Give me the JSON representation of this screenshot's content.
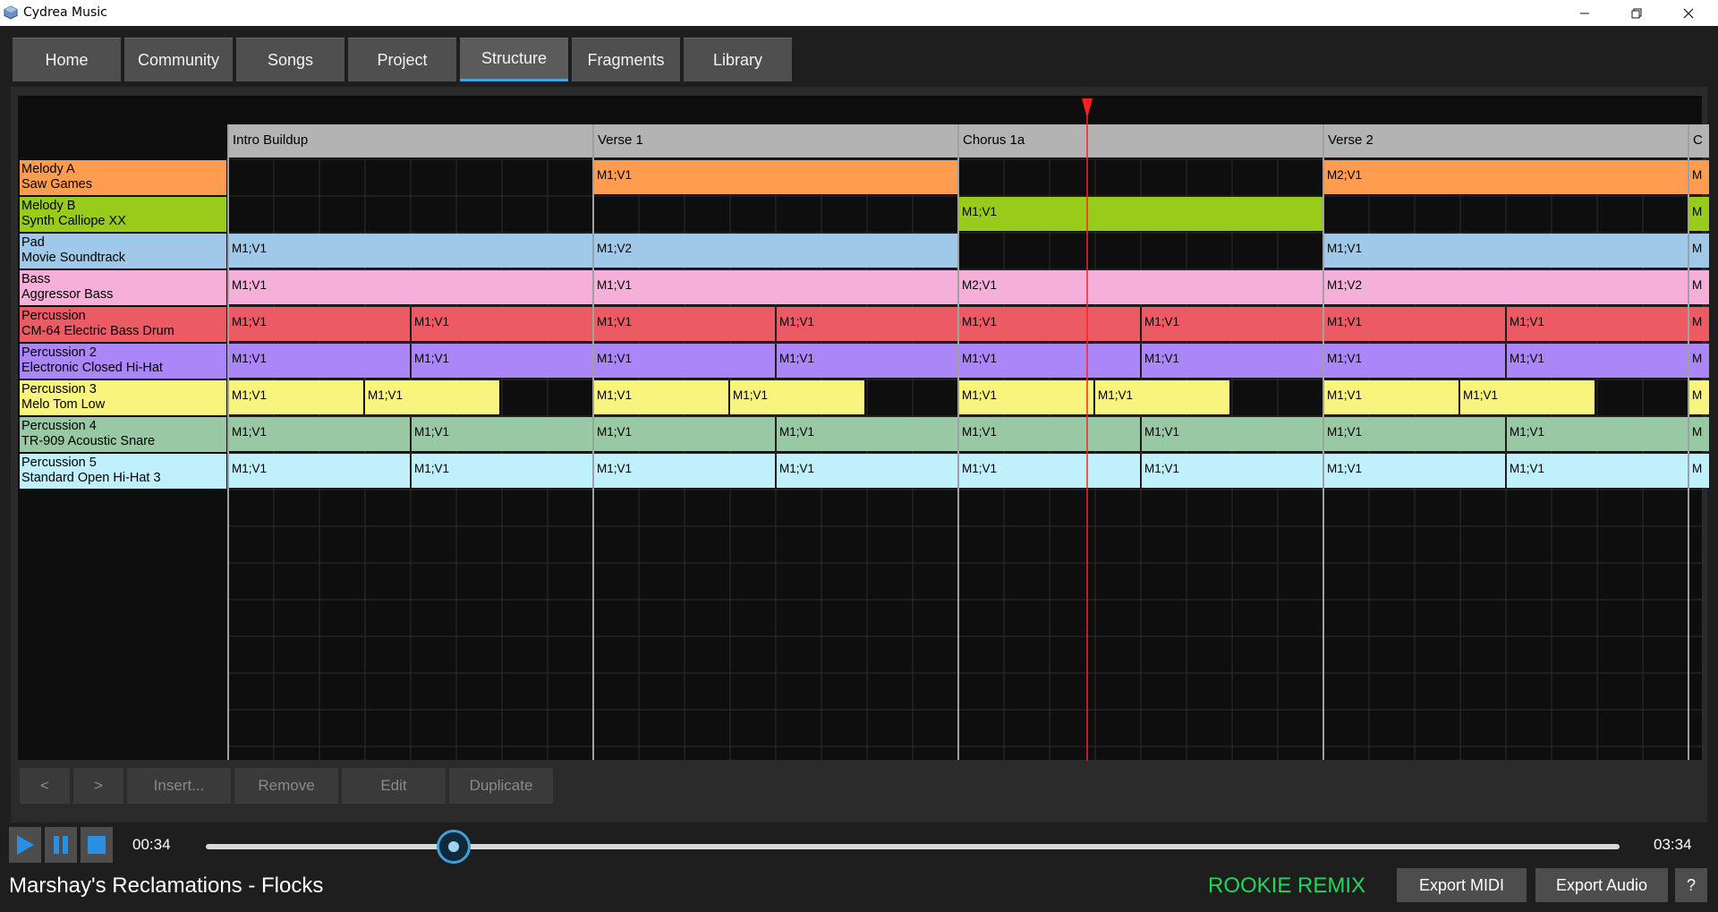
{
  "window": {
    "title": "Cydrea Music",
    "minimize": "—",
    "maximize": "❐",
    "close": "✕"
  },
  "tabs": [
    {
      "label": "Home",
      "active": false
    },
    {
      "label": "Community",
      "active": false
    },
    {
      "label": "Songs",
      "active": false
    },
    {
      "label": "Project",
      "active": false
    },
    {
      "label": "Structure",
      "active": true
    },
    {
      "label": "Fragments",
      "active": false
    },
    {
      "label": "Library",
      "active": false
    }
  ],
  "sections": [
    "Intro Buildup",
    "Verse 1",
    "Chorus 1a",
    "Verse 2",
    "C"
  ],
  "tracks": [
    {
      "name": "Melody A",
      "instrument": "Saw Games",
      "color": "#ff9c50"
    },
    {
      "name": "Melody B",
      "instrument": "Synth Calliope XX",
      "color": "#99cc1a"
    },
    {
      "name": "Pad",
      "instrument": "Movie Soundtrack",
      "color": "#a0c8e8"
    },
    {
      "name": "Bass",
      "instrument": "Aggressor Bass",
      "color": "#f4b0d8"
    },
    {
      "name": "Percussion",
      "instrument": "CM-64 Electric Bass Drum",
      "color": "#ec5a64"
    },
    {
      "name": "Percussion 2",
      "instrument": "Electronic Closed Hi-Hat",
      "color": "#aa86f8"
    },
    {
      "name": "Percussion 3",
      "instrument": "Melo Tom Low",
      "color": "#f8f47e"
    },
    {
      "name": "Percussion 4",
      "instrument": "TR-909 Acoustic Snare",
      "color": "#98c8a4"
    },
    {
      "name": "Percussion 5",
      "instrument": "Standard Open Hi-Hat 3",
      "color": "#c0f0fc"
    }
  ],
  "blocks": [
    [
      "",
      "M1;V1",
      "",
      "M2;V1",
      "M"
    ],
    [
      "",
      "",
      "M1;V1",
      "",
      "M"
    ],
    [
      "M1;V1",
      "M1;V2",
      "",
      "M1;V1",
      "M"
    ],
    [
      "M1;V1",
      "M1;V1",
      "M2;V1",
      "M1;V2",
      "M"
    ],
    [
      "M1;V1|M1;V1",
      "M1;V1|M1;V1",
      "M1;V1|M1;V1",
      "M1;V1|M1;V1",
      "M"
    ],
    [
      "M1;V1|M1;V1",
      "M1;V1|M1;V1",
      "M1;V1|M1;V1",
      "M1;V1|M1;V1",
      "M"
    ],
    [
      "M1;V1|M1;V1",
      "M1;V1|M1;V1",
      "M1;V1|M1;V1",
      "M1;V1|M1;V1",
      "M"
    ],
    [
      "M1;V1|M1;V1",
      "M1;V1|M1;V1",
      "M1;V1|M1;V1",
      "M1;V1|M1;V1",
      "M"
    ],
    [
      "M1;V1|M1;V1",
      "M1;V1|M1;V1",
      "M1;V1|M1;V1",
      "M1;V1|M1;V1",
      "M"
    ]
  ],
  "actions": {
    "prev": "<",
    "next": ">",
    "insert": "Insert...",
    "remove": "Remove",
    "edit": "Edit",
    "duplicate": "Duplicate"
  },
  "transport": {
    "current_time": "00:34",
    "total_time": "03:34",
    "progress": 0.14
  },
  "footer": {
    "song_title": "Marshay's Reclamations - Flocks",
    "mode": "ROOKIE REMIX",
    "export_midi": "Export MIDI",
    "export_audio": "Export Audio",
    "help": "?"
  },
  "colors": {
    "accent": "#4aa3df",
    "playhead": "#ff2020",
    "mode_badge": "#1fd85a"
  }
}
